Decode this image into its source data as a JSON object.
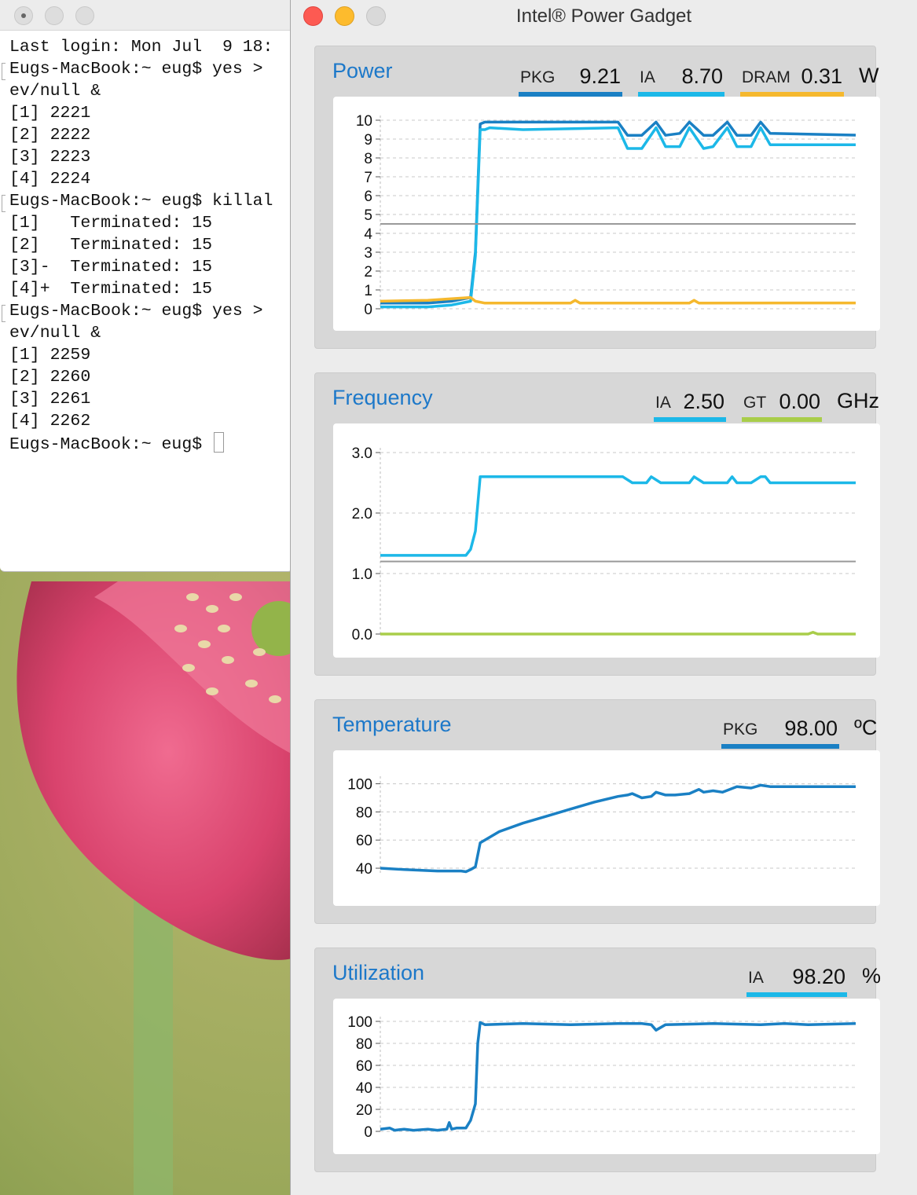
{
  "terminal": {
    "lines": [
      "Last login: Mon Jul  9 18:",
      "Eugs-MacBook:~ eug$ yes >",
      "ev/null &",
      "[1] 2221",
      "[2] 2222",
      "[3] 2223",
      "[4] 2224",
      "Eugs-MacBook:~ eug$ killal",
      "[1]   Terminated: 15",
      "[2]   Terminated: 15",
      "[3]-  Terminated: 15",
      "[4]+  Terminated: 15",
      "Eugs-MacBook:~ eug$ yes >",
      "ev/null &",
      "[1] 2259",
      "[2] 2260",
      "[3] 2261",
      "[4] 2262",
      "Eugs-MacBook:~ eug$ "
    ]
  },
  "gadget": {
    "title": "Intel® Power Gadget",
    "colors": {
      "pkg": "#1a80c4",
      "ia": "#1cb8e8",
      "dram": "#f5b82e",
      "gt": "#a9cd4a",
      "threshold": "#9a9a9a",
      "accent": "#1c78c9"
    },
    "power": {
      "title": "Power",
      "unit": "W",
      "legend": [
        {
          "label": "PKG",
          "value": "9.21"
        },
        {
          "label": "IA",
          "value": "8.70"
        },
        {
          "label": "DRAM",
          "value": "0.31"
        }
      ]
    },
    "frequency": {
      "title": "Frequency",
      "unit": "GHz",
      "legend": [
        {
          "label": "IA",
          "value": "2.50"
        },
        {
          "label": "GT",
          "value": "0.00"
        }
      ]
    },
    "temperature": {
      "title": "Temperature",
      "unit": "ºC",
      "legend": [
        {
          "label": "PKG",
          "value": "98.00"
        }
      ]
    },
    "utilization": {
      "title": "Utilization",
      "unit": "%",
      "legend": [
        {
          "label": "IA",
          "value": "98.20"
        }
      ]
    }
  },
  "chart_data": [
    {
      "type": "line",
      "panel": "power",
      "ylim": [
        0,
        10
      ],
      "yticks": [
        "0",
        "1",
        "2",
        "3",
        "4",
        "5",
        "6",
        "7",
        "8",
        "9",
        "10"
      ],
      "grid": true,
      "series": [
        {
          "name": "PKG",
          "color": "#1a80c4",
          "x": [
            0,
            10,
            15,
            19,
            20,
            21,
            22,
            23,
            30,
            50,
            52,
            55,
            58,
            60,
            63,
            65,
            68,
            70,
            73,
            75,
            78,
            80,
            82,
            100
          ],
          "y": [
            0.3,
            0.3,
            0.4,
            0.6,
            3,
            9.8,
            9.9,
            9.9,
            9.9,
            9.9,
            9.2,
            9.2,
            9.9,
            9.2,
            9.3,
            9.9,
            9.2,
            9.2,
            9.9,
            9.2,
            9.2,
            9.9,
            9.3,
            9.21
          ]
        },
        {
          "name": "IA",
          "color": "#1cb8e8",
          "x": [
            0,
            10,
            15,
            19,
            20,
            21,
            22,
            23,
            30,
            50,
            52,
            55,
            58,
            60,
            63,
            65,
            68,
            70,
            73,
            75,
            78,
            80,
            82,
            100
          ],
          "y": [
            0.1,
            0.1,
            0.2,
            0.4,
            2.8,
            9.5,
            9.5,
            9.6,
            9.5,
            9.6,
            8.5,
            8.5,
            9.6,
            8.6,
            8.6,
            9.6,
            8.5,
            8.6,
            9.6,
            8.6,
            8.6,
            9.6,
            8.7,
            8.7
          ]
        },
        {
          "name": "DRAM",
          "color": "#f5b82e",
          "x": [
            0,
            10,
            19,
            20,
            22,
            40,
            41,
            42,
            65,
            66,
            67,
            100
          ],
          "y": [
            0.4,
            0.45,
            0.6,
            0.4,
            0.3,
            0.3,
            0.45,
            0.3,
            0.3,
            0.45,
            0.3,
            0.31
          ]
        },
        {
          "name": "",
          "color": "#9a9a9a",
          "x": [
            0,
            100
          ],
          "y": [
            4.5,
            4.5
          ]
        }
      ]
    },
    {
      "type": "line",
      "panel": "frequency",
      "ylim": [
        0,
        3
      ],
      "yticks": [
        "0.0",
        "1.0",
        "2.0",
        "3.0"
      ],
      "grid": true,
      "series": [
        {
          "name": "IA",
          "color": "#1cb8e8",
          "x": [
            0,
            18,
            19,
            20,
            21,
            30,
            51,
            53,
            56,
            57,
            59,
            61,
            65,
            66,
            68,
            70,
            73,
            74,
            75,
            78,
            80,
            81,
            82,
            100
          ],
          "y": [
            1.3,
            1.3,
            1.4,
            1.7,
            2.6,
            2.6,
            2.6,
            2.5,
            2.5,
            2.6,
            2.5,
            2.5,
            2.5,
            2.6,
            2.5,
            2.5,
            2.5,
            2.6,
            2.5,
            2.5,
            2.6,
            2.6,
            2.5,
            2.5
          ]
        },
        {
          "name": "GT",
          "color": "#a9cd4a",
          "x": [
            0,
            90,
            91,
            92,
            100
          ],
          "y": [
            0,
            0,
            0.03,
            0,
            0
          ]
        },
        {
          "name": "",
          "color": "#9a9a9a",
          "x": [
            0,
            100
          ],
          "y": [
            1.2,
            1.2
          ]
        }
      ]
    },
    {
      "type": "line",
      "panel": "temperature",
      "ylim": [
        35,
        102
      ],
      "yticks": [
        "40",
        "60",
        "80",
        "100"
      ],
      "grid": true,
      "series": [
        {
          "name": "PKG",
          "color": "#1a80c4",
          "x": [
            0,
            5,
            12,
            17,
            18,
            19,
            20,
            21,
            25,
            30,
            35,
            40,
            45,
            50,
            52,
            53,
            55,
            57,
            58,
            60,
            62,
            65,
            67,
            68,
            70,
            72,
            75,
            78,
            80,
            82,
            100
          ],
          "y": [
            40,
            39,
            38,
            38,
            37.5,
            39,
            41,
            58,
            66,
            72,
            77,
            82,
            87,
            91,
            92,
            93,
            90,
            91,
            94,
            92,
            92,
            93,
            96,
            94,
            95,
            94,
            98,
            97,
            99,
            98,
            98
          ]
        }
      ]
    },
    {
      "type": "line",
      "panel": "utilization",
      "ylim": [
        0,
        100
      ],
      "yticks": [
        "0",
        "20",
        "40",
        "60",
        "80",
        "100"
      ],
      "grid": true,
      "series": [
        {
          "name": "IA",
          "color": "#1a80c4",
          "x": [
            0,
            2,
            3,
            5,
            7,
            10,
            12,
            14,
            14.5,
            15,
            16,
            18,
            19,
            20,
            20.5,
            21,
            22,
            30,
            40,
            50,
            55,
            57,
            58,
            60,
            70,
            80,
            85,
            90,
            100
          ],
          "y": [
            2,
            3,
            1,
            2,
            1,
            2,
            1,
            2,
            8,
            2,
            3,
            3,
            10,
            25,
            80,
            99,
            97,
            98,
            97,
            98,
            98,
            97,
            92,
            97,
            98,
            97,
            98,
            97,
            98
          ]
        }
      ]
    }
  ]
}
